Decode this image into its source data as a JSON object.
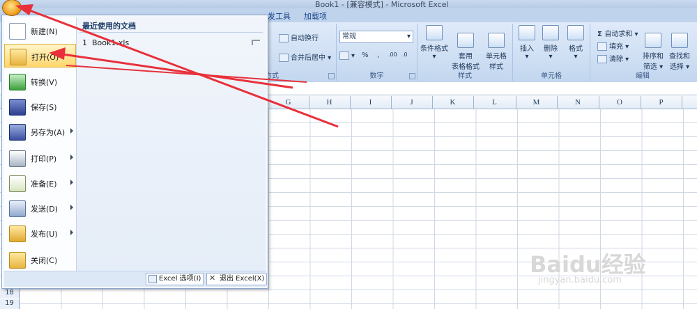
{
  "window": {
    "title": "Book1 - [兼容模式] - Microsoft Excel"
  },
  "ribbon_tabs": [
    "发工具",
    "加载项"
  ],
  "ribbon": {
    "alignment": {
      "wrap": "自动换行",
      "merge": "合并后居中 ▾",
      "label": "方式"
    },
    "number": {
      "format": "常规",
      "percent": "%",
      "comma": ",",
      "inc": ".00",
      "dec": ".0",
      "label": "数字"
    },
    "styles": {
      "conditional": "条件格式",
      "table": "套用\n表格格式",
      "cell": "单元格\n样式",
      "label": "样式"
    },
    "cells": {
      "insert": "插入",
      "delete": "删除",
      "format": "格式",
      "label": "单元格"
    },
    "editing": {
      "autosum": "自动求和 ▾",
      "fill": "填充 ▾",
      "clear": "清除 ▾",
      "sort": "排序和\n筛选 ▾",
      "find": "查找和\n选择 ▾",
      "label": "编辑"
    }
  },
  "columns": [
    "G",
    "H",
    "I",
    "J",
    "K",
    "L",
    "M",
    "N",
    "O",
    "P"
  ],
  "rows": [
    "18",
    "19"
  ],
  "menu": {
    "items": [
      {
        "label": "新建(N)",
        "icon": "new-doc-icon",
        "arrow": false
      },
      {
        "label": "打开(O)",
        "icon": "open-folder-icon",
        "arrow": false,
        "highlight": true
      },
      {
        "label": "转换(V)",
        "icon": "convert-icon",
        "arrow": false
      },
      {
        "label": "保存(S)",
        "icon": "save-icon",
        "arrow": false
      },
      {
        "label": "另存为(A)",
        "icon": "save-as-icon",
        "arrow": true
      },
      {
        "label": "打印(P)",
        "icon": "print-icon",
        "arrow": true
      },
      {
        "label": "准备(E)",
        "icon": "prepare-icon",
        "arrow": true
      },
      {
        "label": "发送(D)",
        "icon": "send-icon",
        "arrow": true
      },
      {
        "label": "发布(U)",
        "icon": "publish-icon",
        "arrow": true
      },
      {
        "label": "关闭(C)",
        "icon": "close-folder-icon",
        "arrow": false
      }
    ],
    "recent_title": "最近使用的文档",
    "recent_docs": [
      {
        "num": "1",
        "name": "Book1.xls"
      }
    ],
    "options_label": "Excel 选项(I)",
    "exit_label": "退出 Excel(X)"
  },
  "watermark": {
    "brand": "Baidu经验",
    "url": "jingyan.baidu.com"
  }
}
